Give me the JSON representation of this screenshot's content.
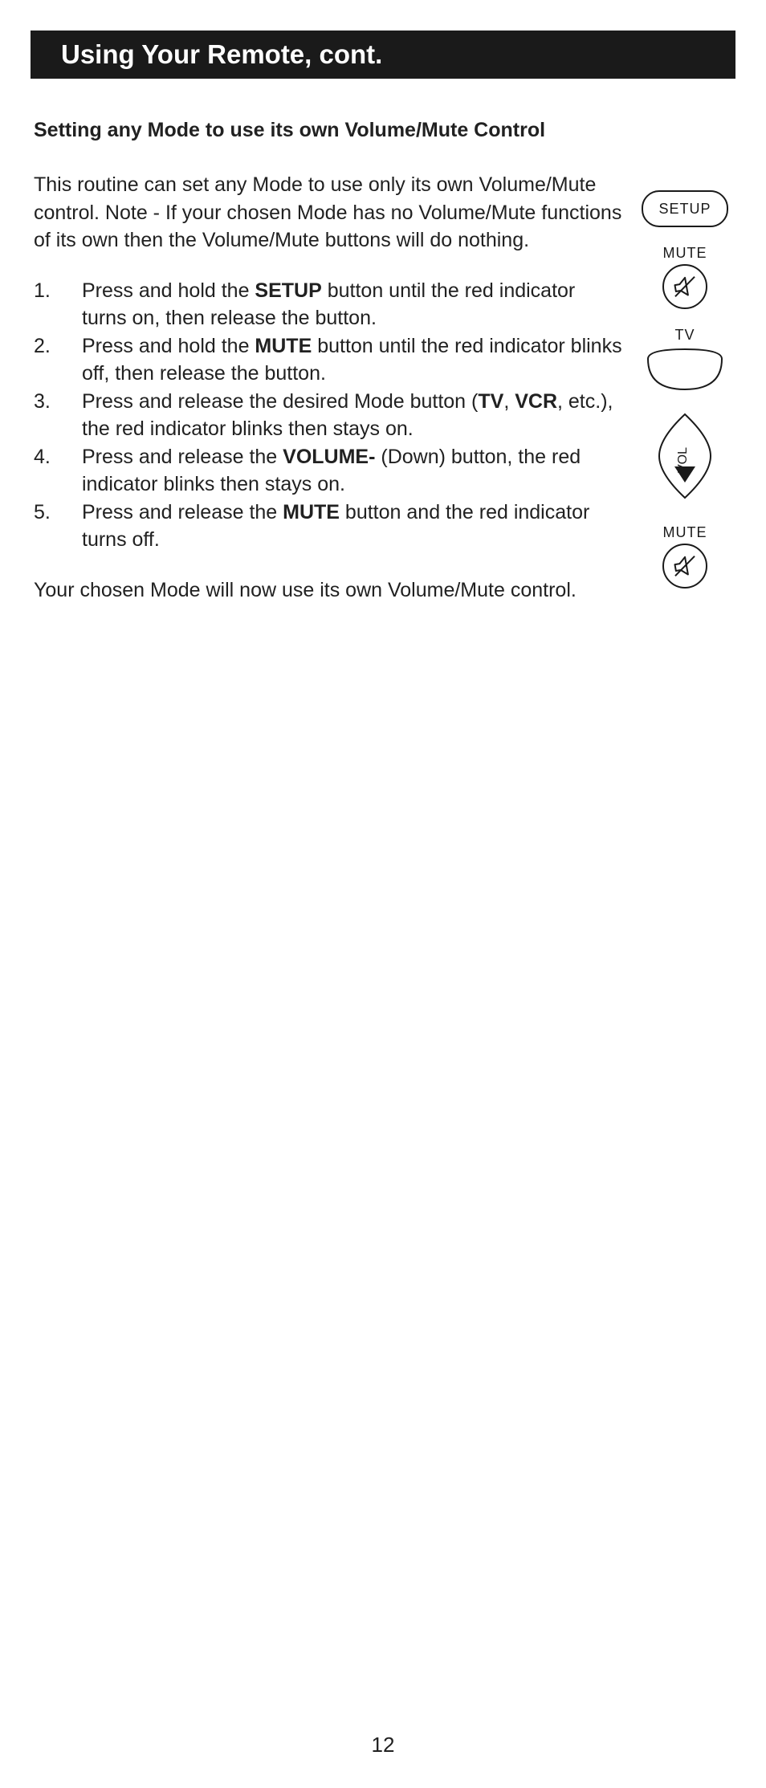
{
  "title": "Using Your Remote, cont.",
  "subheading": "Setting any Mode to use its own Volume/Mute Control",
  "intro": "This routine can set any Mode to use only its own Volume/Mute control. Note - If your chosen Mode has no Volume/Mute functions of its own then the Volume/Mute buttons will do nothing.",
  "steps": [
    {
      "pre": "Press and hold the ",
      "bold": "SETUP",
      "post": " button until the red indicator turns on, then release the button."
    },
    {
      "pre": "Press and hold the ",
      "bold": "MUTE",
      "post": " button until the red indicator blinks off, then release the button."
    },
    {
      "pre": "Press and release the desired Mode button (",
      "bold": "TV",
      "mid": ", ",
      "bold2": "VCR",
      "post": ", etc.), the red indicator blinks then stays on."
    },
    {
      "pre": "Press and release the ",
      "bold": "VOLUME-",
      "post": " (Down) button, the red indicator blinks then stays on."
    },
    {
      "pre": "Press and release the ",
      "bold": "MUTE",
      "post": " button and the red indicator turns off."
    }
  ],
  "outro": "Your chosen Mode will now use its own Volume/Mute control.",
  "buttons": {
    "setup": "SETUP",
    "mute": "MUTE",
    "tv": "TV",
    "vol": "VOL"
  },
  "page_number": "12"
}
